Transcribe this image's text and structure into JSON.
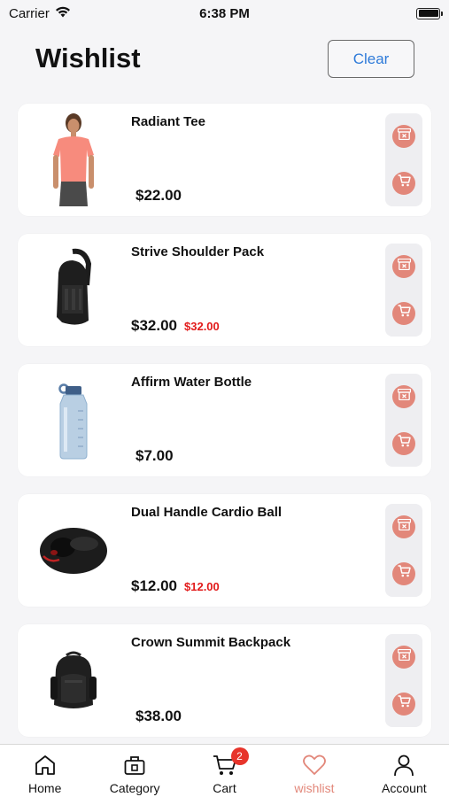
{
  "status_bar": {
    "carrier": "Carrier",
    "time": "6:38 PM"
  },
  "header": {
    "title": "Wishlist",
    "clear_label": "Clear"
  },
  "items": [
    {
      "name": "Radiant Tee",
      "price": "$22.00",
      "old_price": "",
      "image": "tshirt-photo"
    },
    {
      "name": "Strive Shoulder Pack",
      "price": "$32.00",
      "old_price": "$32.00",
      "image": "sling-bag-photo"
    },
    {
      "name": "Affirm Water Bottle",
      "price": "$7.00",
      "old_price": "",
      "image": "water-bottle-photo"
    },
    {
      "name": "Dual Handle Cardio Ball",
      "price": "$12.00",
      "old_price": "$12.00",
      "image": "cardio-ball-photo"
    },
    {
      "name": "Crown Summit Backpack",
      "price": "$38.00",
      "old_price": "",
      "image": "backpack-photo"
    }
  ],
  "tabs": [
    {
      "label": "Home",
      "icon": "home-icon",
      "active": false
    },
    {
      "label": "Category",
      "icon": "category-icon",
      "active": false
    },
    {
      "label": "Cart",
      "icon": "cart-icon",
      "active": false,
      "badge": "2"
    },
    {
      "label": "wishlist",
      "icon": "heart-icon",
      "active": true
    },
    {
      "label": "Account",
      "icon": "person-icon",
      "active": false
    }
  ],
  "colors": {
    "accent": "#e2877a",
    "link": "#2f7bd9",
    "sale": "#e21b1b",
    "badge": "#e7342b"
  }
}
